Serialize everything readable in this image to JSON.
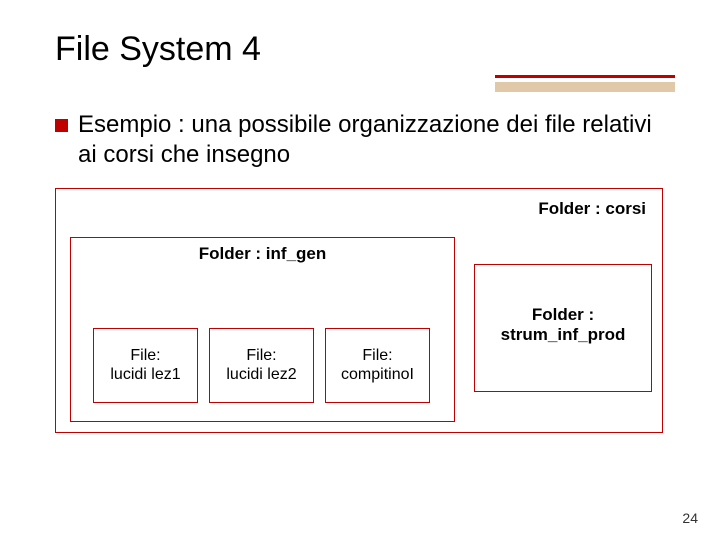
{
  "title": "File System  4",
  "bullet": "Esempio : una possibile organizzazione dei file relativi ai corsi che insegno",
  "folder_corsi": "Folder : corsi",
  "folder_infgen": "Folder : inf_gen",
  "file1_line1": "File:",
  "file1_line2": "lucidi lez1",
  "file2_line1": "File:",
  "file2_line2": "lucidi lez2",
  "file3_line1": "File:",
  "file3_line2": "compitinoI",
  "folder_strum_line1": "Folder :",
  "folder_strum_line2": "strum_inf_prod",
  "page_number": "24"
}
